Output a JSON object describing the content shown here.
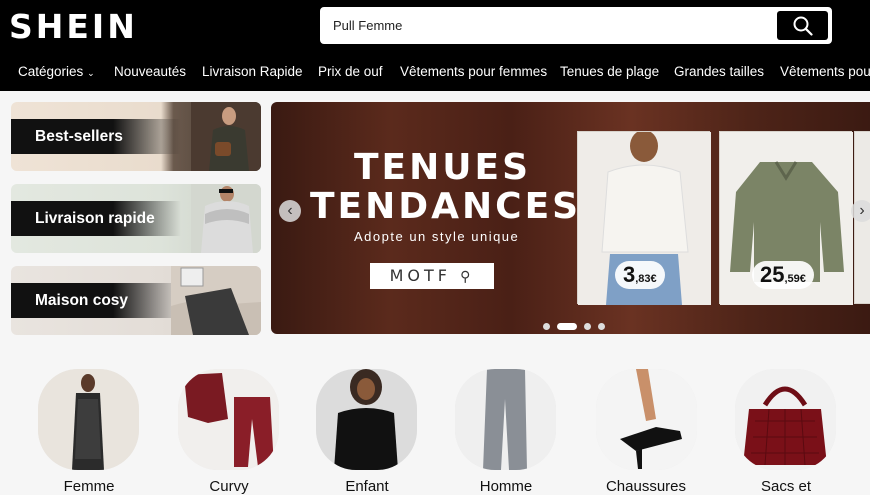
{
  "header": {
    "logo": "SHEIN",
    "search_value": "Pull Femme"
  },
  "nav": {
    "items": [
      "Catégories",
      "Nouveautés",
      "Livraison Rapide",
      "Prix de ouf",
      "Vêtements pour femmes",
      "Tenues de plage",
      "Grandes tailles",
      "Vêtements pour"
    ]
  },
  "side_cards": [
    {
      "label": "Best-sellers"
    },
    {
      "label": "Livraison rapide"
    },
    {
      "label": "Maison cosy"
    }
  ],
  "banner": {
    "title_line1": "TENUES",
    "title_line2": "TENDANCES",
    "subtitle": "Adopte un style unique",
    "code": "MOTF ",
    "products": [
      {
        "price_main": "3",
        "price_cents": ",83€"
      },
      {
        "price_main": "25",
        "price_cents": ",59€"
      }
    ],
    "slides": 4,
    "active_slide": 1
  },
  "categories": [
    {
      "label": "Femme"
    },
    {
      "label": "Curvy"
    },
    {
      "label": "Enfant"
    },
    {
      "label": "Homme"
    },
    {
      "label": "Chaussures"
    },
    {
      "label": "Sacs et"
    }
  ]
}
